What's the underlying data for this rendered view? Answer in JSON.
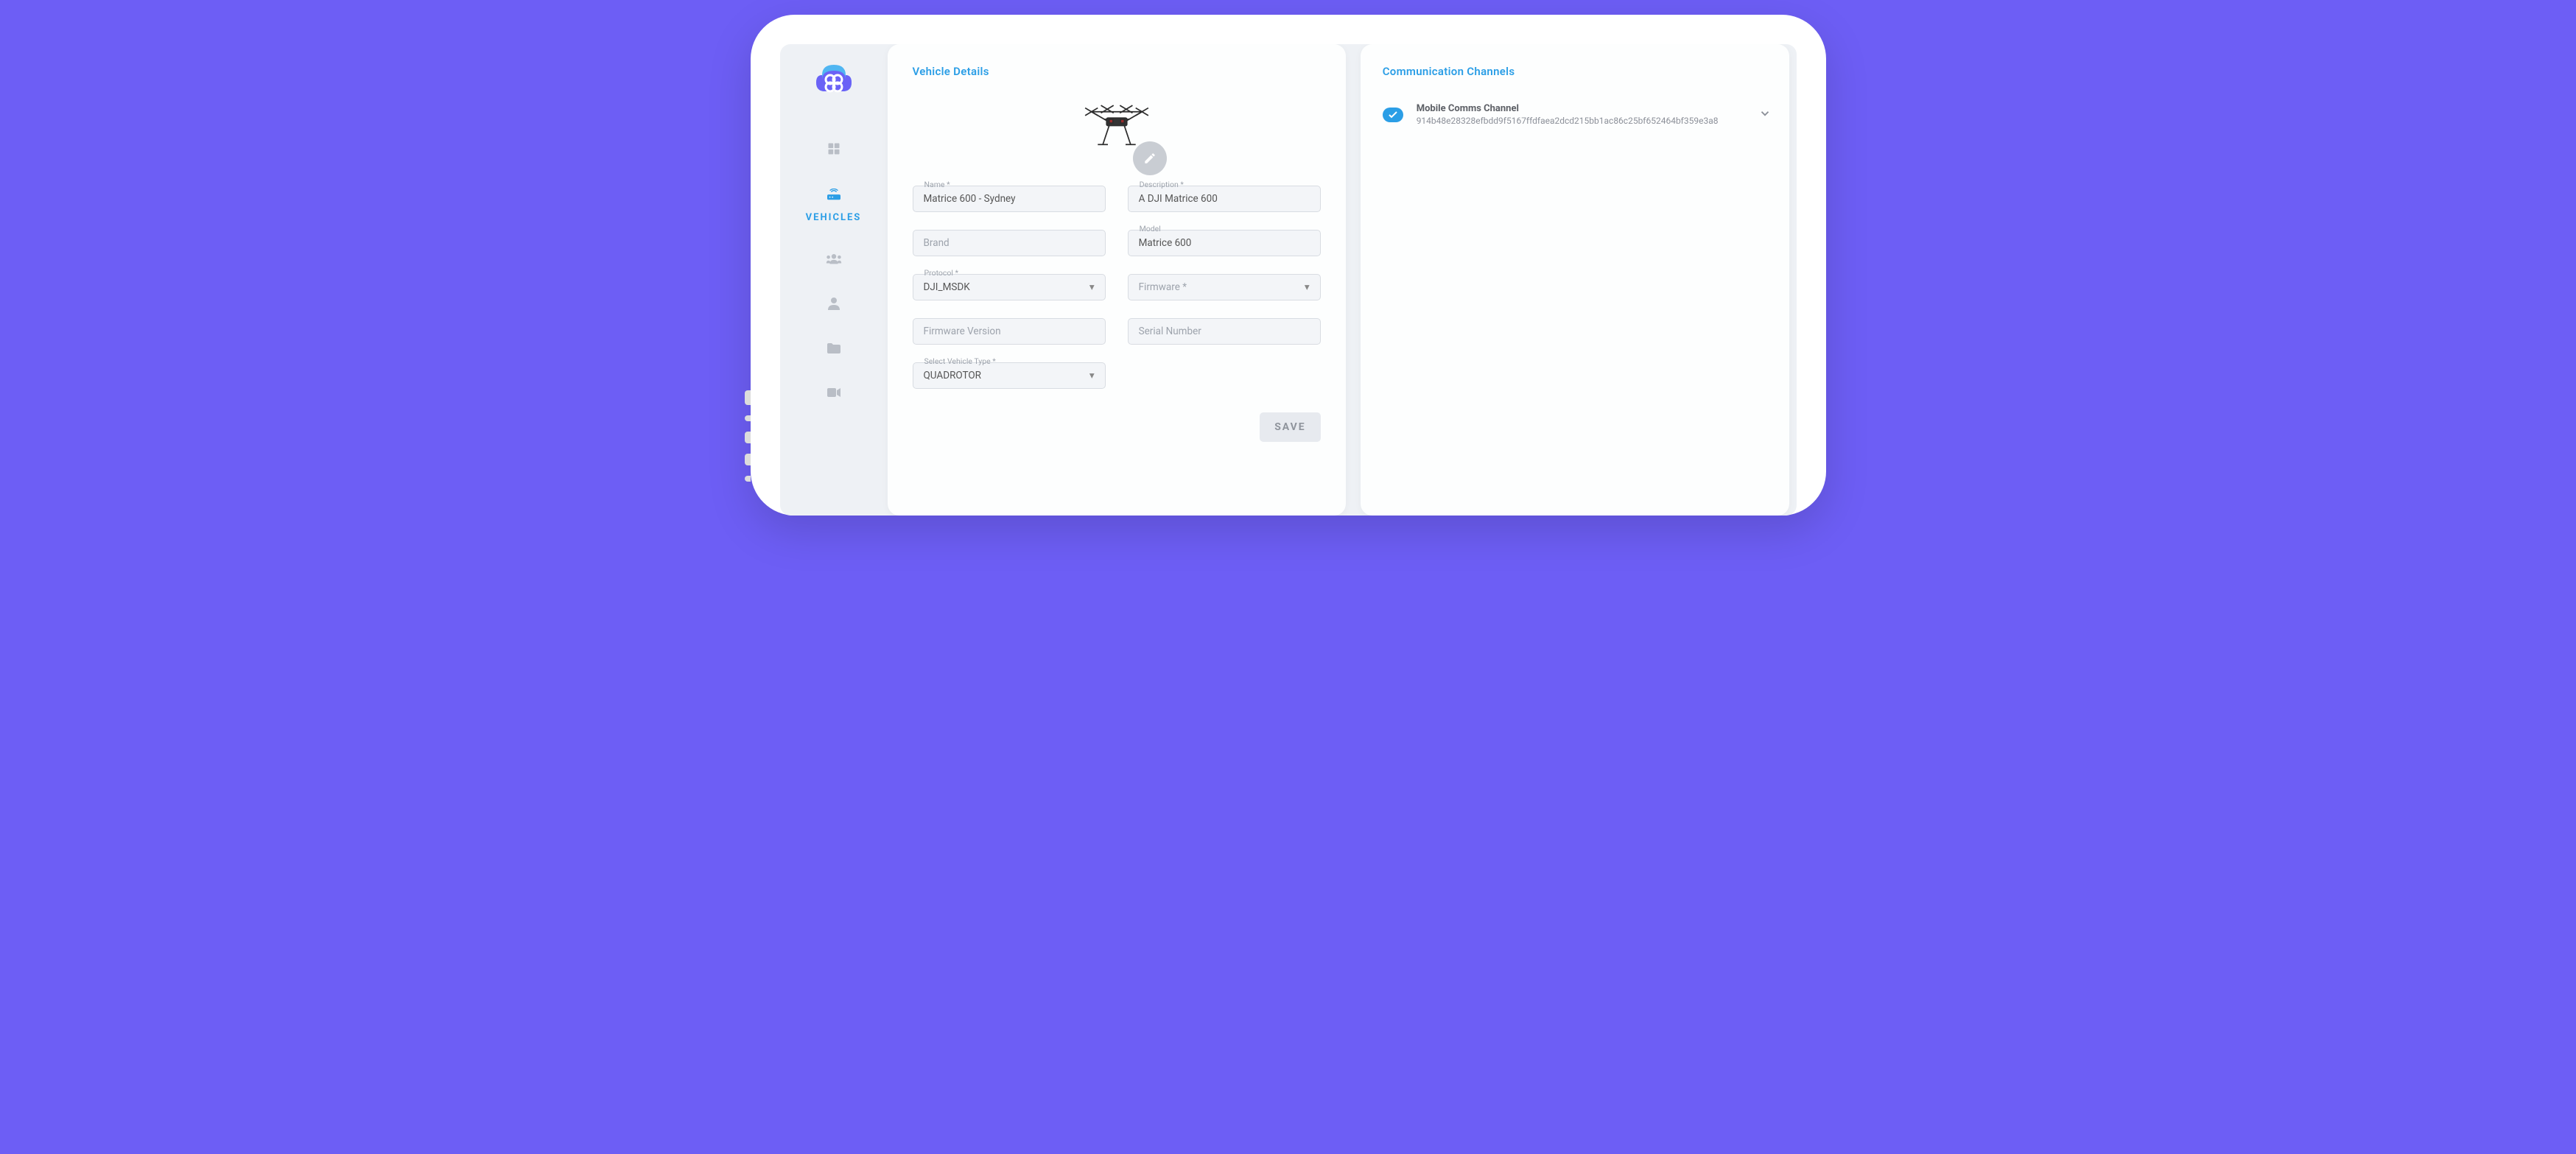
{
  "sidebar": {
    "items": [
      {
        "label": "",
        "icon": "dashboard"
      },
      {
        "label": "VEHICLES",
        "icon": "vehicle-router"
      },
      {
        "label": "",
        "icon": "people"
      },
      {
        "label": "",
        "icon": "person"
      },
      {
        "label": "",
        "icon": "folder"
      },
      {
        "label": "",
        "icon": "videocam"
      }
    ],
    "active_index": 1
  },
  "vehicle_details": {
    "title": "Vehicle Details",
    "fields": {
      "name_label": "Name *",
      "name_value": "Matrice 600 - Sydney",
      "description_label": "Description *",
      "description_value": "A DJI Matrice 600",
      "brand_label": "",
      "brand_placeholder": "Brand",
      "brand_value": "",
      "model_label": "Model",
      "model_value": "Matrice 600",
      "protocol_label": "Protocol *",
      "protocol_value": "DJI_MSDK",
      "firmware_label": "",
      "firmware_placeholder": "Firmware *",
      "firmware_value": "",
      "firmware_version_label": "",
      "firmware_version_placeholder": "Firmware Version",
      "firmware_version_value": "",
      "serial_label": "",
      "serial_placeholder": "Serial Number",
      "serial_value": "",
      "vehicle_type_label": "Select Vehicle Type *",
      "vehicle_type_value": "QUADROTOR"
    },
    "save_label": "SAVE"
  },
  "comm_channels": {
    "title": "Communication Channels",
    "items": [
      {
        "name": "Mobile Comms Channel",
        "id": "914b48e28328efbdd9f5167ffdfaea2dcd215bb1ac86c25bf652464bf359e3a8"
      }
    ]
  },
  "colors": {
    "accent": "#2b9ee6",
    "bg_outer": "#6d5ef5"
  }
}
